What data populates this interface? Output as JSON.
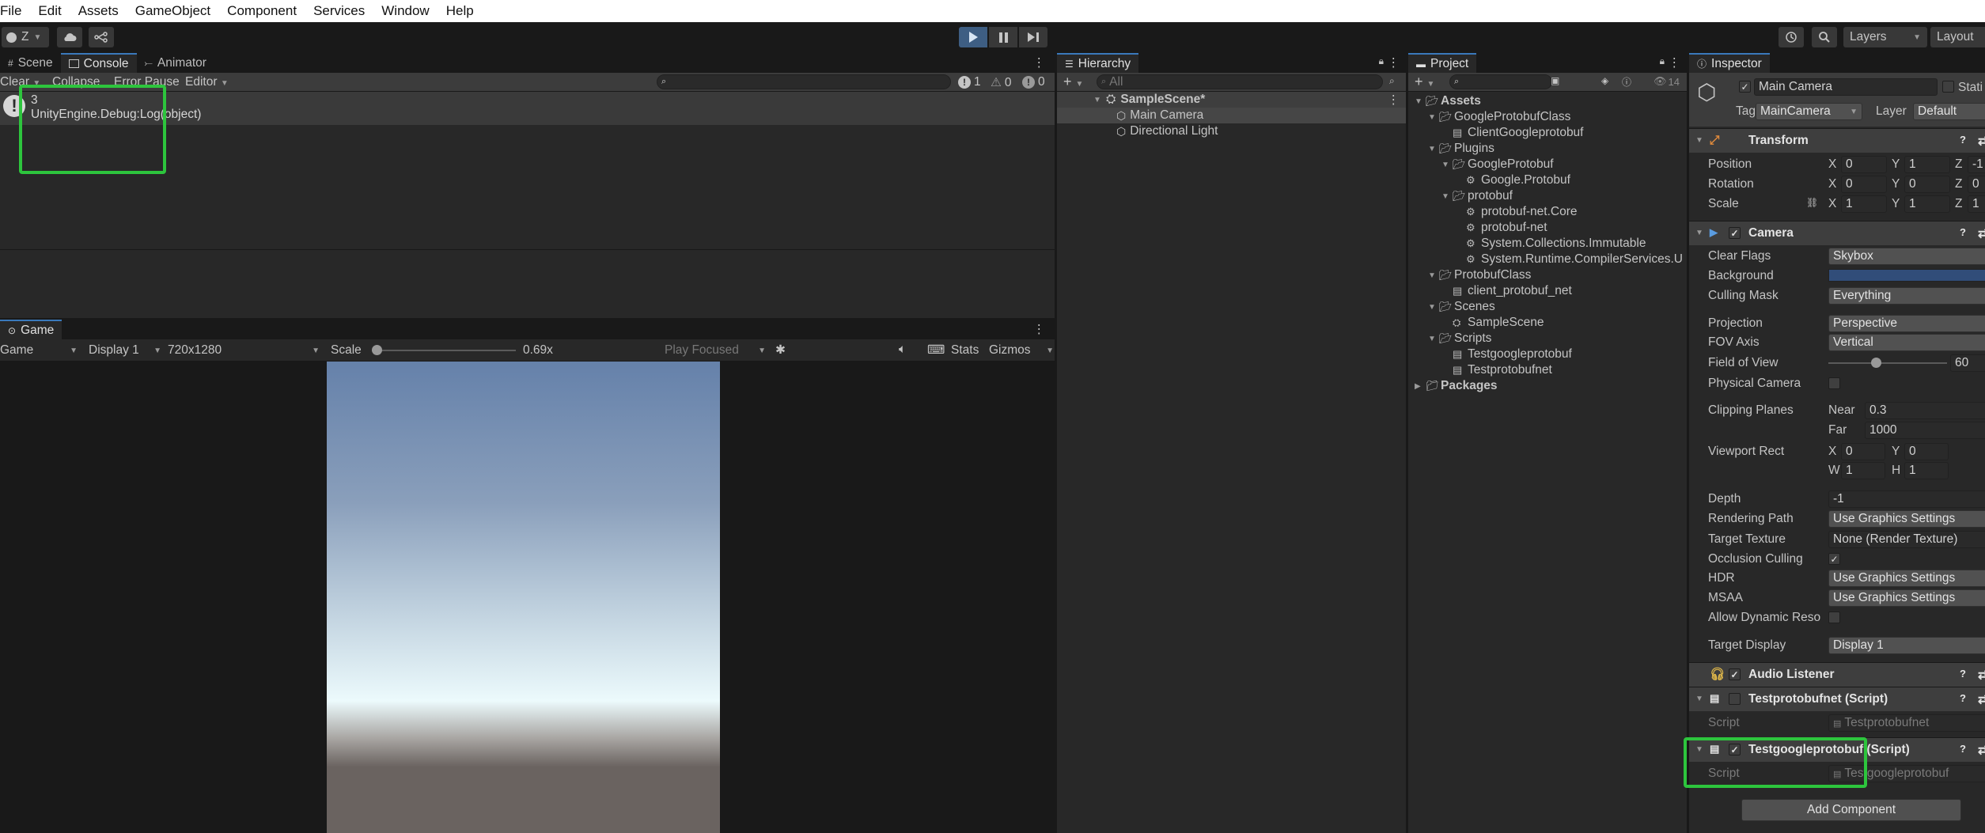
{
  "menubar": {
    "items": [
      "File",
      "Edit",
      "Assets",
      "GameObject",
      "Component",
      "Services",
      "Window",
      "Help"
    ]
  },
  "toolbar": {
    "account_label": "Z",
    "layers_label": "Layers",
    "layout_label": "Layout"
  },
  "top_tabs": {
    "scene": "Scene",
    "console": "Console",
    "animator": "Animator"
  },
  "console": {
    "clear": "Clear",
    "collapse": "Collapse",
    "error_pause": "Error Pause",
    "editor": "Editor",
    "count_info": "1",
    "count_warn": "0",
    "count_error": "0",
    "entries": [
      {
        "line1": "3",
        "line2": "UnityEngine.Debug:Log(object)"
      }
    ]
  },
  "game": {
    "tab": "Game",
    "mode": "Game",
    "display": "Display 1",
    "resolution": "720x1280",
    "scale_label": "Scale",
    "scale_value": "0.69x",
    "scale_level": 0.0,
    "play_focused": "Play Focused",
    "stats": "Stats",
    "gizmos": "Gizmos"
  },
  "hierarchy": {
    "tab": "Hierarchy",
    "search_placeholder": "All",
    "scene": "SampleScene*",
    "items": [
      "Main Camera",
      "Directional Light"
    ]
  },
  "project": {
    "tab": "Project",
    "hidden_count": "14",
    "tree": [
      {
        "label": "Assets",
        "level": 0,
        "kind": "folder-open",
        "bold": true
      },
      {
        "label": "GoogleProtobufClass",
        "level": 1,
        "kind": "folder-open"
      },
      {
        "label": "ClientGoogleprotobuf",
        "level": 2,
        "kind": "script"
      },
      {
        "label": "Plugins",
        "level": 1,
        "kind": "folder-open"
      },
      {
        "label": "GoogleProtobuf",
        "level": 2,
        "kind": "folder-open"
      },
      {
        "label": "Google.Protobuf",
        "level": 3,
        "kind": "dll"
      },
      {
        "label": "protobuf",
        "level": 2,
        "kind": "folder-open"
      },
      {
        "label": "protobuf-net.Core",
        "level": 3,
        "kind": "dll"
      },
      {
        "label": "protobuf-net",
        "level": 3,
        "kind": "dll"
      },
      {
        "label": "System.Collections.Immutable",
        "level": 3,
        "kind": "dll"
      },
      {
        "label": "System.Runtime.CompilerServices.U",
        "level": 3,
        "kind": "dll"
      },
      {
        "label": "ProtobufClass",
        "level": 1,
        "kind": "folder-open"
      },
      {
        "label": "client_protobuf_net",
        "level": 2,
        "kind": "script"
      },
      {
        "label": "Scenes",
        "level": 1,
        "kind": "folder-open"
      },
      {
        "label": "SampleScene",
        "level": 2,
        "kind": "scene"
      },
      {
        "label": "Scripts",
        "level": 1,
        "kind": "folder-open"
      },
      {
        "label": "Testgoogleprotobuf",
        "level": 2,
        "kind": "script"
      },
      {
        "label": "Testprotobufnet",
        "level": 2,
        "kind": "script"
      },
      {
        "label": "Packages",
        "level": 0,
        "kind": "folder-closed",
        "bold": true
      }
    ]
  },
  "inspector": {
    "tab": "Inspector",
    "object_name": "Main Camera",
    "static_label": "Stati",
    "tag_label": "Tag",
    "tag_value": "MainCamera",
    "layer_label": "Layer",
    "layer_value": "Default",
    "transform": {
      "title": "Transform",
      "rows": [
        {
          "label": "Position",
          "x": "0",
          "y": "1",
          "z": "-1"
        },
        {
          "label": "Rotation",
          "x": "0",
          "y": "0",
          "z": "0"
        },
        {
          "label": "Scale",
          "x": "1",
          "y": "1",
          "z": "1"
        }
      ]
    },
    "camera": {
      "title": "Camera",
      "clear_flags_label": "Clear Flags",
      "clear_flags": "Skybox",
      "background_label": "Background",
      "background_color": "#314d79",
      "culling_mask_label": "Culling Mask",
      "culling_mask": "Everything",
      "projection_label": "Projection",
      "projection": "Perspective",
      "fov_axis_label": "FOV Axis",
      "fov_axis": "Vertical",
      "fov_label": "Field of View",
      "fov": "60",
      "physical_label": "Physical Camera",
      "clipping_label": "Clipping Planes",
      "near_label": "Near",
      "near": "0.3",
      "far_label": "Far",
      "far": "1000",
      "viewport_label": "Viewport Rect",
      "vx": "0",
      "vy": "0",
      "vw": "1",
      "vh": "1",
      "depth_label": "Depth",
      "depth": "-1",
      "rendering_path_label": "Rendering Path",
      "rendering_path": "Use Graphics Settings",
      "target_texture_label": "Target Texture",
      "target_texture": "None (Render Texture)",
      "occlusion_label": "Occlusion Culling",
      "hdr_label": "HDR",
      "hdr": "Use Graphics Settings",
      "msaa_label": "MSAA",
      "msaa": "Use Graphics Settings",
      "dynres_label": "Allow Dynamic Reso",
      "target_display_label": "Target Display",
      "target_display": "Display 1"
    },
    "audio_listener": {
      "title": "Audio Listener"
    },
    "script1": {
      "title": "Testprotobufnet (Script)",
      "script_label": "Script",
      "script_value": "Testprotobufnet"
    },
    "script2": {
      "title": "Testgoogleprotobuf (Script)",
      "script_label": "Script",
      "script_value": "Testgoogleprotobuf"
    },
    "add_component": "Add Component"
  },
  "colors": {
    "accent": "#3a79bb",
    "highlight_box": "#2dc53d",
    "sky_top": "#6581aa",
    "horizon": "#ecfafc",
    "ground": "#6a6360"
  }
}
